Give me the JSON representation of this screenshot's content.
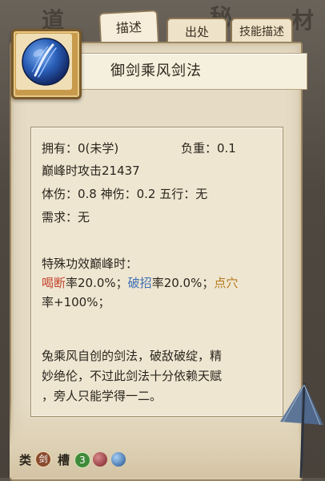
{
  "tabs": [
    {
      "label": "描述"
    },
    {
      "label": "出处"
    },
    {
      "label": "技能描述"
    }
  ],
  "skill": {
    "name": "御剑乘风剑法",
    "icon": "blue-orb-sword-icon"
  },
  "stats": {
    "owned": "拥有：0(未学)",
    "weight": "负重：0.1",
    "peak_attack": "巅峰时攻击21437",
    "damages": "体伤：0.8  神伤：0.2  五行：无",
    "requirement": "需求：无"
  },
  "special": {
    "heading": "特殊功效巅峰时：",
    "e1_name": "喝断",
    "e1_text": "率20.0%；",
    "e2_name": "破招",
    "e2_text": "率20.0%；",
    "e3_name": "点穴",
    "e3_text": "率+100%；"
  },
  "description": [
    "兔乘风自创的剑法，破敌破绽，精",
    "妙绝伦，不过此剑法十分依赖天赋",
    "，旁人只能学得一二。"
  ],
  "bottom": {
    "type_label": "类",
    "type_value": "剑",
    "slot_label": "槽",
    "slot_count": "3"
  },
  "colors": {
    "panel": "#e6dcc6",
    "highlight_red": "#c2452d",
    "highlight_blue": "#3e6fb3",
    "highlight_gold": "#b57a1c"
  }
}
